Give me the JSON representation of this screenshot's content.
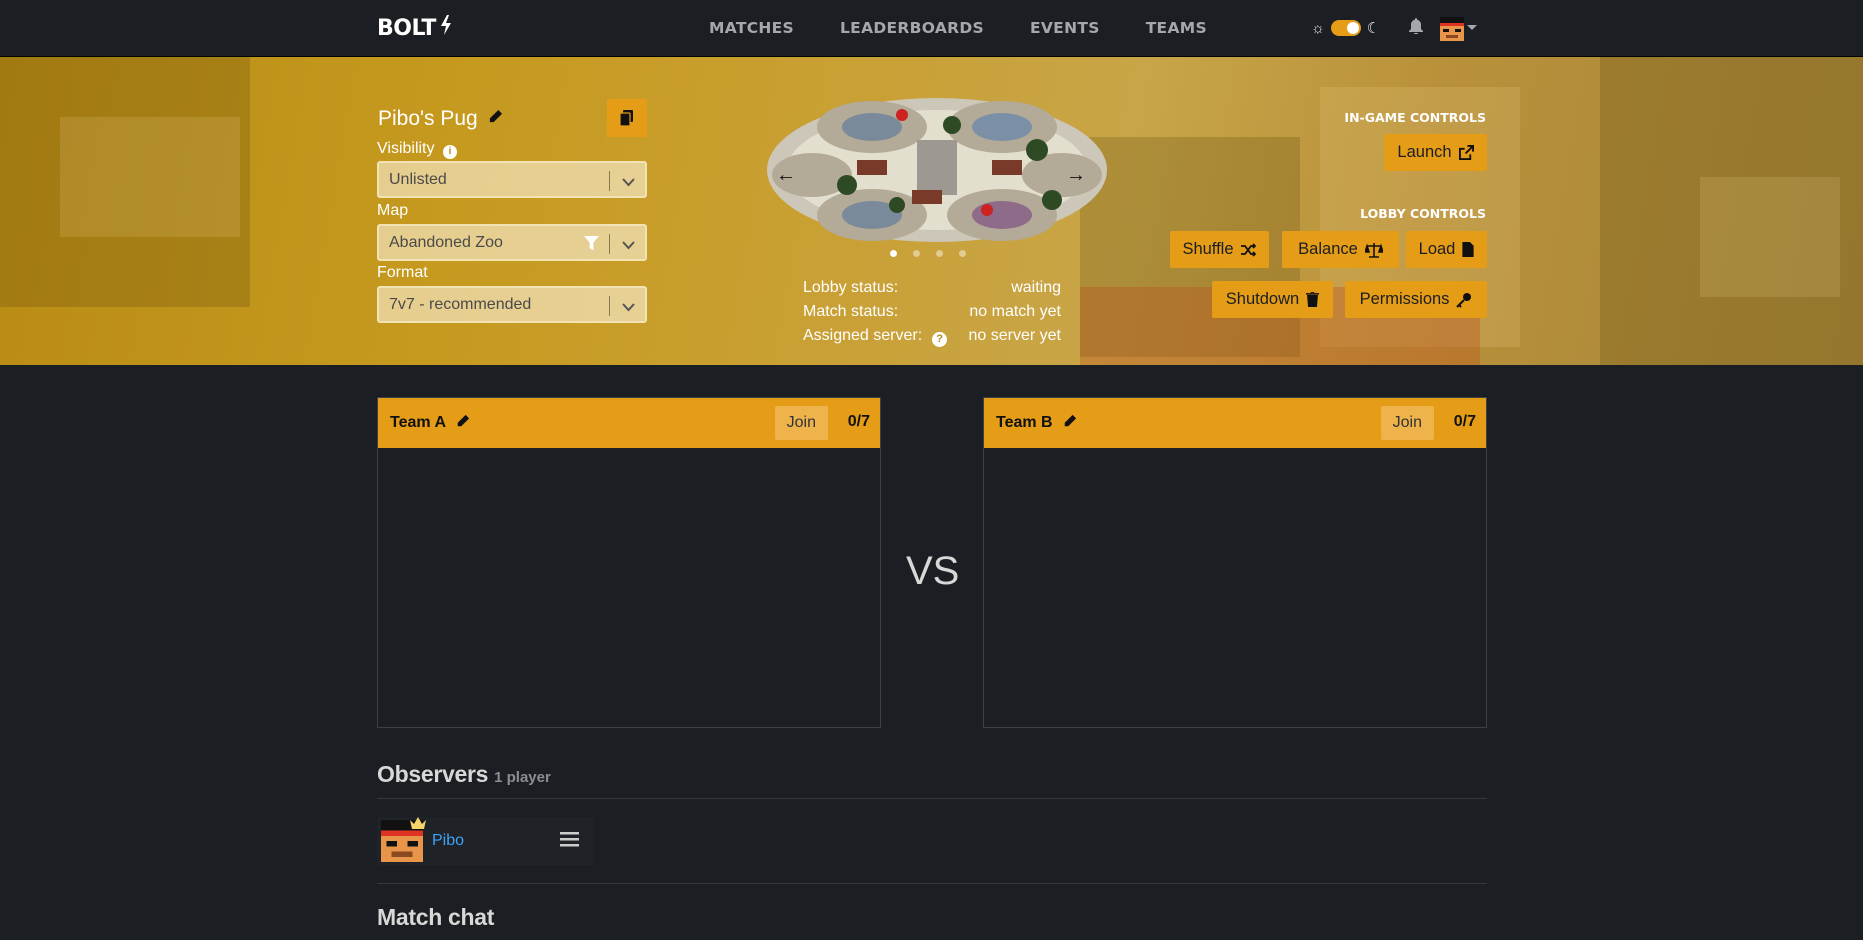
{
  "nav": {
    "logo": "BOLT",
    "links": [
      "MATCHES",
      "LEADERBOARDS",
      "EVENTS",
      "TEAMS"
    ]
  },
  "lobby": {
    "title": "Pibo's Pug",
    "visibility_label": "Visibility",
    "visibility_value": "Unlisted",
    "map_label": "Map",
    "map_value": "Abandoned Zoo",
    "format_label": "Format",
    "format_value": "7v7 - recommended"
  },
  "status": {
    "lobby_label": "Lobby status:",
    "lobby_value": "waiting",
    "match_label": "Match status:",
    "match_value": "no match yet",
    "server_label": "Assigned server:",
    "server_value": "no server yet"
  },
  "carousel": {
    "slides": 4,
    "active": 0
  },
  "controls": {
    "ingame_title": "IN-GAME CONTROLS",
    "launch": "Launch",
    "lobby_title": "LOBBY CONTROLS",
    "shuffle": "Shuffle",
    "balance": "Balance",
    "load": "Load",
    "shutdown": "Shutdown",
    "permissions": "Permissions"
  },
  "teams": [
    {
      "name": "Team A",
      "join": "Join",
      "count": "0/7"
    },
    {
      "name": "Team B",
      "join": "Join",
      "count": "0/7"
    }
  ],
  "vs": "VS",
  "observers": {
    "title": "Observers",
    "count": "1 player",
    "players": [
      {
        "name": "Pibo",
        "is_leader": true
      }
    ]
  },
  "chat": {
    "title": "Match chat"
  },
  "colors": {
    "accent": "#e59c17",
    "background": "#1b1e22",
    "link": "#3fa3f5"
  }
}
